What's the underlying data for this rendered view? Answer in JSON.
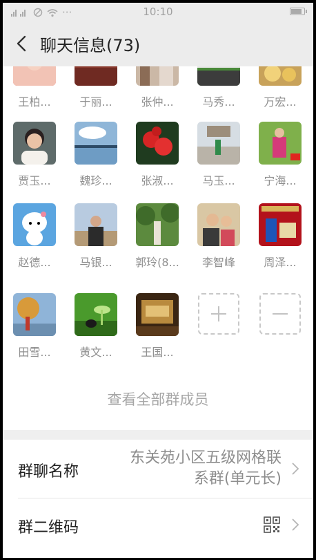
{
  "status_bar": {
    "time": "10:10",
    "dots": "···"
  },
  "nav": {
    "title": "聊天信息(73)"
  },
  "members": [
    {
      "name": "王柏..."
    },
    {
      "name": "于丽..."
    },
    {
      "name": "张仲..."
    },
    {
      "name": "马秀..."
    },
    {
      "name": "万宏..."
    },
    {
      "name": "贾玉..."
    },
    {
      "name": "魏珍..."
    },
    {
      "name": "张淑..."
    },
    {
      "name": "马玉..."
    },
    {
      "name": "宁海..."
    },
    {
      "name": "赵德..."
    },
    {
      "name": "马银..."
    },
    {
      "name": "郭玲(8..."
    },
    {
      "name": "李智峰"
    },
    {
      "name": "周泽..."
    },
    {
      "name": "田雪..."
    },
    {
      "name": "黄文..."
    },
    {
      "name": "王国..."
    }
  ],
  "view_all_label": "查看全部群成员",
  "settings": {
    "group_name_label": "群聊名称",
    "group_name_value_line1": "东关苑小区五级网格联",
    "group_name_value_line2": "系群(单元长)",
    "qr_label": "群二维码"
  },
  "colors": {
    "nav_bg": "#ececec",
    "divider": "#efefef",
    "label": "#222222",
    "muted": "#8f8f8f"
  }
}
